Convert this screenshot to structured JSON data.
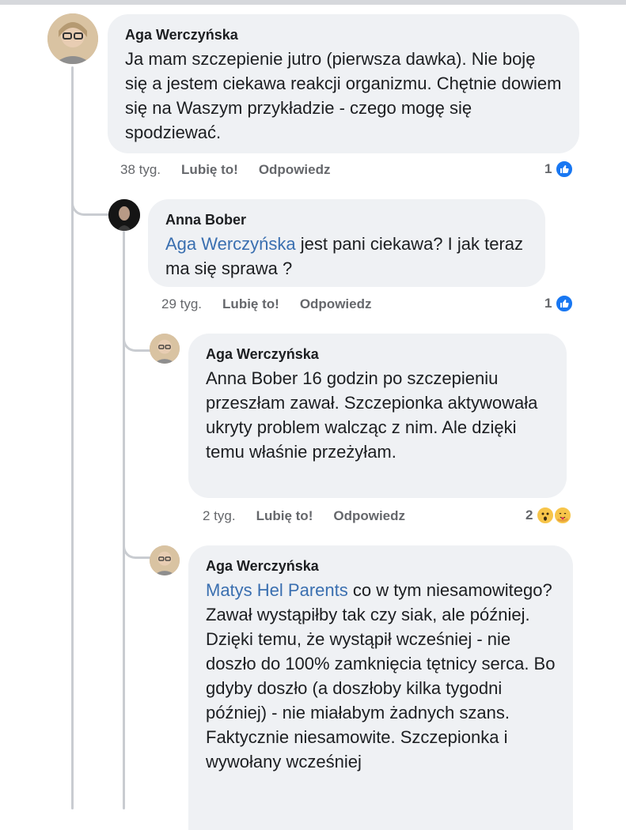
{
  "comments": [
    {
      "author": "Aga Werczyńska",
      "text": "Ja mam szczepienie jutro (pierwsza dawka). Nie boję się a jestem ciekawa reakcji organizmu. Chętnie dowiem się na Waszym przykładzie - czego mogę się spodziewać.",
      "time": "38 tyg.",
      "like_label": "Lubię to!",
      "reply_label": "Odpowiedz",
      "reaction_count": "1"
    },
    {
      "author": "Anna Bober",
      "mention": "Aga Werczyńska",
      "text": " jest pani ciekawa? I jak teraz ma się sprawa ?",
      "time": "29 tyg.",
      "like_label": "Lubię to!",
      "reply_label": "Odpowiedz",
      "reaction_count": "1"
    },
    {
      "author": "Aga Werczyńska",
      "text": "Anna Bober 16 godzin po szczepieniu przeszłam zawał. Szczepionka aktywowała ukryty problem walcząc z nim. Ale dzięki temu właśnie przeżyłam.",
      "time": "2 tyg.",
      "like_label": "Lubię to!",
      "reply_label": "Odpowiedz",
      "reaction_count": "2"
    },
    {
      "author": "Aga Werczyńska",
      "mention": "Matys Hel Parents",
      "text": " co w tym niesamowitego? Zawał wystąpiłby tak czy siak, ale później. Dzięki temu, że wystąpił wcześniej - nie doszło do 100% zamknięcia tętnicy serca. Bo gdyby doszło (a doszłoby kilka tygodni później) - nie miałabym żadnych szans. Faktycznie niesamowite. Szczepionka i wywołany wcześniej"
    }
  ],
  "colors": {
    "bubble": "#eff1f4",
    "mention": "#3a6fb0",
    "like_blue": "#1877f2",
    "meta_gray": "#65676b"
  },
  "icons": [
    "like-icon",
    "wow-emoji-icon",
    "care-emoji-icon"
  ]
}
